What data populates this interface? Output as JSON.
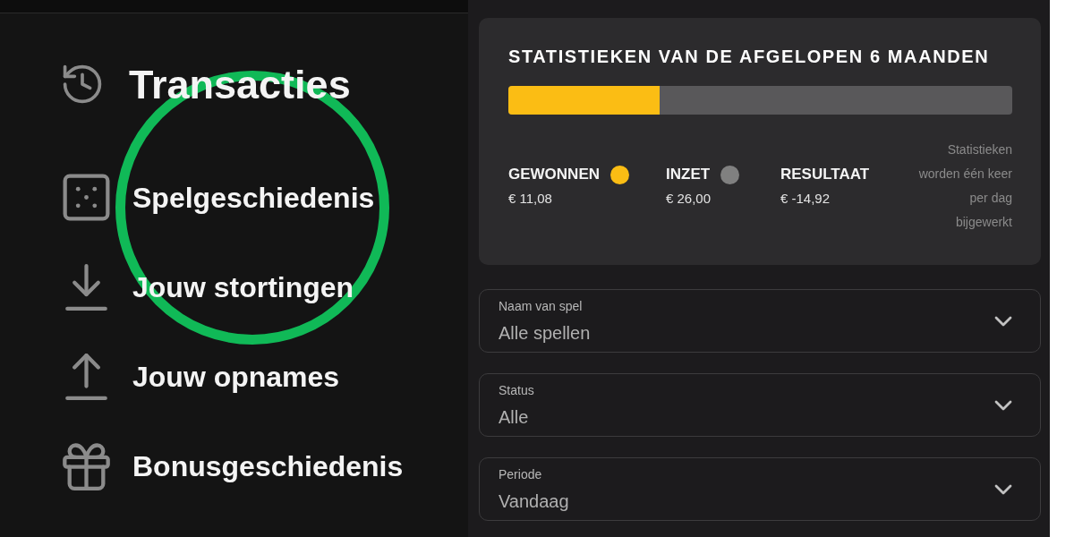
{
  "sidebar": {
    "title": "Transacties",
    "items": [
      {
        "label": "Spelgeschiedenis",
        "circled": true
      },
      {
        "label": "Jouw stortingen",
        "circled": false
      },
      {
        "label": "Jouw opnames",
        "circled": false
      },
      {
        "label": "Bonusgeschiedenis",
        "circled": false
      }
    ]
  },
  "stats": {
    "title": "STATISTIEKEN VAN DE AFGELOPEN 6 MAANDEN",
    "progress": {
      "level": 0.3
    },
    "legend": [
      {
        "label": "GEWONNEN",
        "color": "#fbbd14",
        "value": "€ 11,08"
      },
      {
        "label": "INZET",
        "color": "#808080",
        "value": "€ 26,00"
      },
      {
        "label": "RESULTAAT",
        "value": "€ -14,92"
      }
    ],
    "note": "Statistieken worden één keer per dag bijgewerkt"
  },
  "filters": [
    {
      "label": "Naam van spel",
      "value": "Alle spellen"
    },
    {
      "label": "Status",
      "value": "Alle"
    },
    {
      "label": "Periode",
      "value": "Vandaag"
    }
  ]
}
